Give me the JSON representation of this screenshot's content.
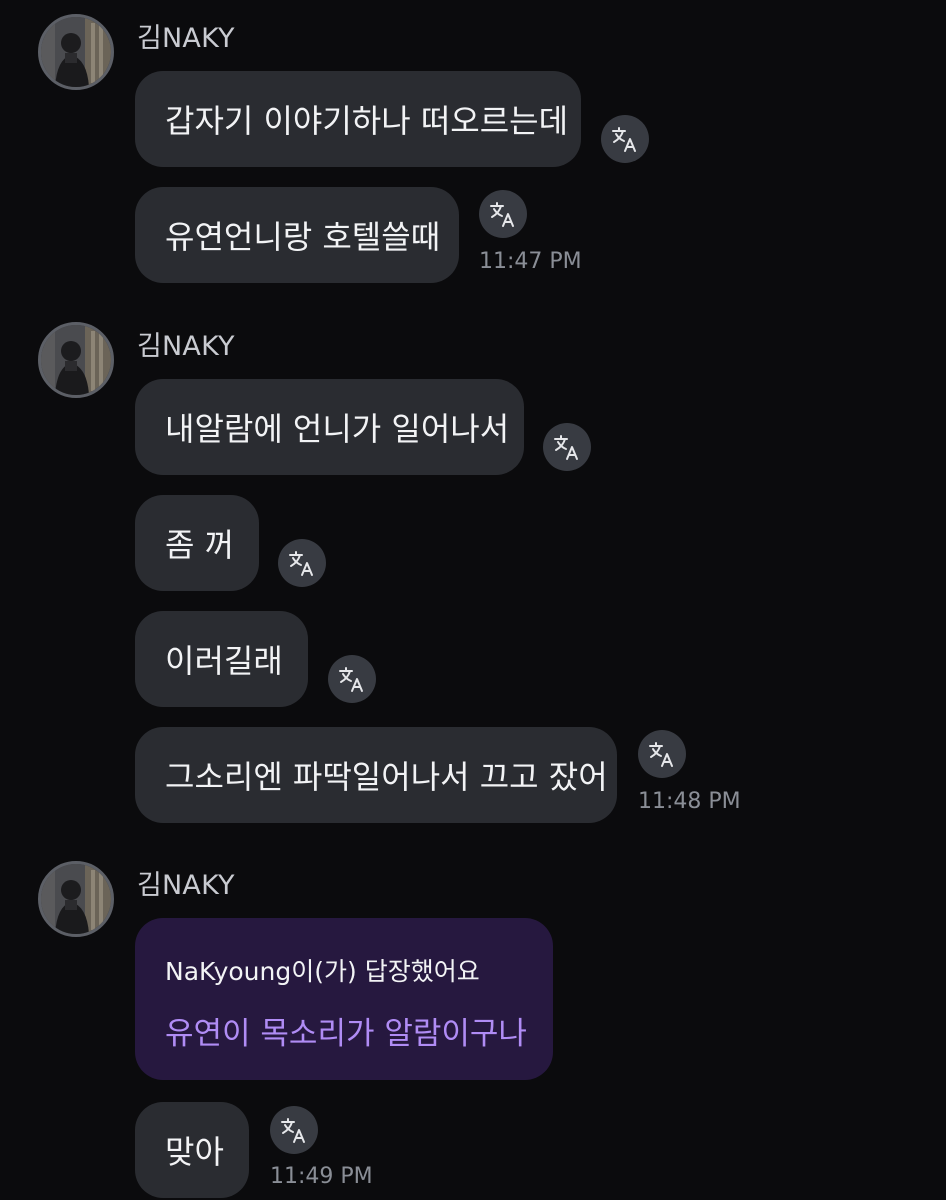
{
  "groups": [
    {
      "sender": "김NAKY",
      "messages": [
        {
          "text": "갑자기 이야기하나 떠오르는데"
        },
        {
          "text": "유연언니랑 호텔쓸때",
          "time": "11:47 PM"
        }
      ]
    },
    {
      "sender": "김NAKY",
      "messages": [
        {
          "text": "내알람에 언니가 일어나서"
        },
        {
          "text": "좀 꺼"
        },
        {
          "text": "이러길래"
        },
        {
          "text": "그소리엔 파딱일어나서 끄고 잤어",
          "time": "11:48 PM"
        }
      ]
    },
    {
      "sender": "김NAKY",
      "reply": {
        "label": "NaKyoung이(가) 답장했어요",
        "text": "유연이 목소리가 알람이구나"
      },
      "messages": [
        {
          "text": "맞아",
          "time": "11:49 PM"
        }
      ]
    }
  ],
  "icons": {
    "translate": "translate-icon",
    "avatar": "profile-avatar"
  },
  "colors": {
    "background": "#0b0b0d",
    "bubble": "#2a2c31",
    "reply_bubble": "#26183f",
    "reply_text": "#b08cf5",
    "timestamp": "#8a8e96"
  }
}
